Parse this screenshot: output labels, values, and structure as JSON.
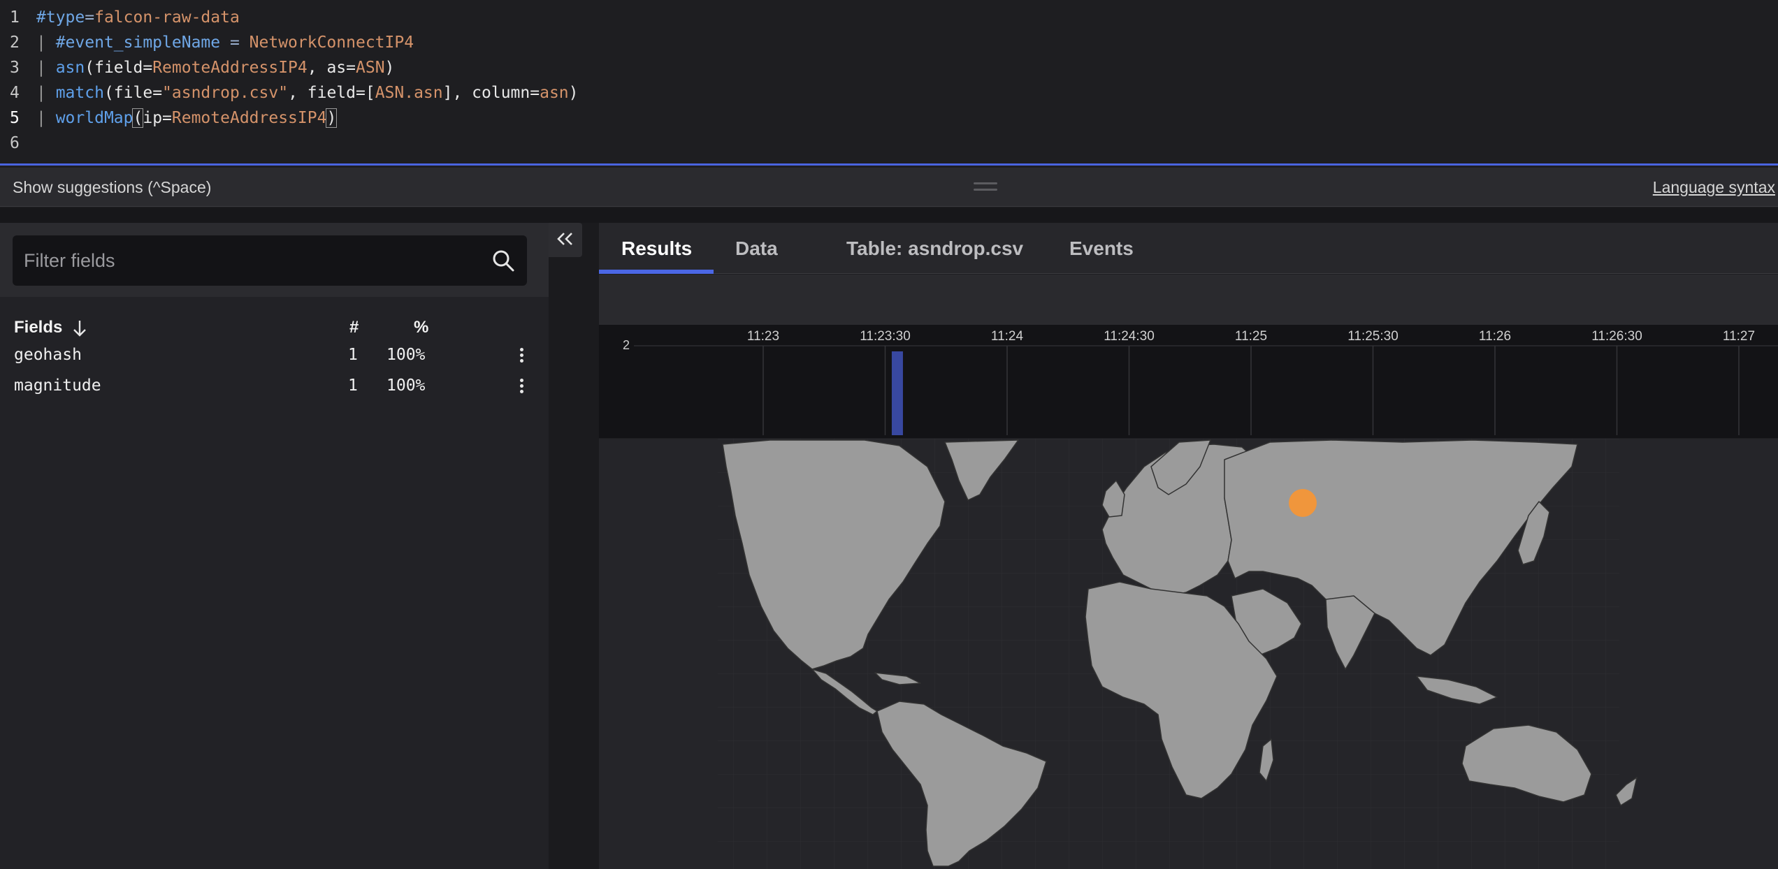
{
  "editor": {
    "line_numbers": [
      "1",
      "2",
      "3",
      "4",
      "5",
      "6"
    ],
    "lines": [
      [
        {
          "t": "#type",
          "c": "key"
        },
        {
          "t": "=",
          "c": "op"
        },
        {
          "t": "falcon-raw-data",
          "c": "val"
        }
      ],
      [
        {
          "t": "| ",
          "c": "pipe"
        },
        {
          "t": "#event_simpleName",
          "c": "key"
        },
        {
          "t": " = ",
          "c": "op"
        },
        {
          "t": "NetworkConnectIP4",
          "c": "val"
        }
      ],
      [
        {
          "t": "| ",
          "c": "pipe"
        },
        {
          "t": "asn",
          "c": "fn"
        },
        {
          "t": "(field=",
          "c": "plain"
        },
        {
          "t": "RemoteAddressIP4",
          "c": "val"
        },
        {
          "t": ", as=",
          "c": "plain"
        },
        {
          "t": "ASN",
          "c": "val"
        },
        {
          "t": ")",
          "c": "plain"
        }
      ],
      [
        {
          "t": "| ",
          "c": "pipe"
        },
        {
          "t": "match",
          "c": "fn"
        },
        {
          "t": "(file=",
          "c": "plain"
        },
        {
          "t": "\"asndrop.csv\"",
          "c": "str"
        },
        {
          "t": ", field=[",
          "c": "plain"
        },
        {
          "t": "ASN.asn",
          "c": "val"
        },
        {
          "t": "], column=",
          "c": "plain"
        },
        {
          "t": "asn",
          "c": "val"
        },
        {
          "t": ")",
          "c": "plain"
        }
      ],
      [
        {
          "t": "| ",
          "c": "pipe"
        },
        {
          "t": "worldMap",
          "c": "fn"
        },
        {
          "t": "(",
          "c": "br"
        },
        {
          "t": "ip=",
          "c": "plain"
        },
        {
          "t": "RemoteAddressIP4",
          "c": "val"
        },
        {
          "t": ")",
          "c": "br"
        }
      ],
      []
    ]
  },
  "suggestions": {
    "label": "Show suggestions (^Space)",
    "language_syntax": "Language syntax"
  },
  "fields_panel": {
    "filter_placeholder": "Filter fields",
    "header": {
      "label": "Fields",
      "count": "#",
      "percent": "%"
    },
    "rows": [
      {
        "name": "geohash",
        "count": "1",
        "percent": "100%"
      },
      {
        "name": "magnitude",
        "count": "1",
        "percent": "100%"
      }
    ]
  },
  "tabs": [
    {
      "label": "Results",
      "active": true
    },
    {
      "label": "Data",
      "active": false
    },
    {
      "label": "Table: asndrop.csv",
      "active": false
    },
    {
      "label": "Events",
      "active": false
    }
  ],
  "chart_data": {
    "type": "bar",
    "categories": [
      "11:23",
      "11:23:30",
      "11:24",
      "11:24:30",
      "11:25",
      "11:25:30",
      "11:26",
      "11:26:30",
      "11:27"
    ],
    "y_tick": "2",
    "ylim": [
      0,
      2
    ],
    "bars": [
      {
        "x": "11:23:33",
        "value": 2
      }
    ],
    "bar_color": "#3848a0",
    "grid": true
  },
  "world_map": {
    "land_color": "#9b9b9b",
    "border_color": "#333333",
    "points": [
      {
        "region": "Eastern Europe",
        "color": "#f0963c"
      }
    ]
  },
  "colors": {
    "accent": "#4b67e5",
    "map_point": "#f0963c",
    "histogram_bar": "#3848a0"
  }
}
